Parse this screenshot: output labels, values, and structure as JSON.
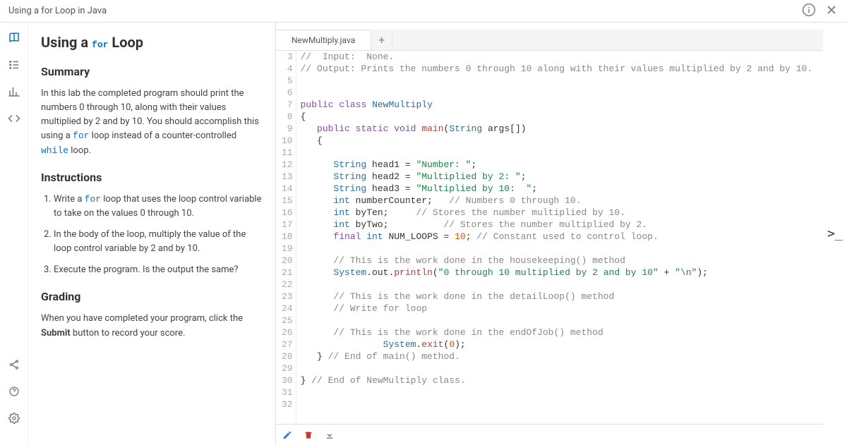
{
  "topbar": {
    "title": "Using a for Loop in Java"
  },
  "sidebar": {
    "icons": [
      "book",
      "list",
      "chart",
      "code"
    ],
    "bottom_icons": [
      "share",
      "help",
      "settings"
    ]
  },
  "instructions": {
    "title_pre": "Using a ",
    "title_code": "for",
    "title_post": " Loop",
    "summary_heading": "Summary",
    "summary_p1_pre": "In this lab the completed program should print the numbers 0 through 10, along with their values multiplied by 2 and by 10. You should accomplish this using a ",
    "summary_p1_code1": "for",
    "summary_p1_mid": " loop instead of a counter-controlled ",
    "summary_p1_code2": "while",
    "summary_p1_post": " loop.",
    "instructions_heading": "Instructions",
    "step1_pre": "Write a ",
    "step1_code": "for",
    "step1_post": " loop that uses the loop control variable to take on the values 0 through 10.",
    "step2": "In the body of the loop, multiply the value of the loop control variable by 2 and by 10.",
    "step3": "Execute the program. Is the output the same?",
    "grading_heading": "Grading",
    "grading_text": "When you have completed your program, click the Submit button to record your score.",
    "grading_bold": "Submit"
  },
  "editor": {
    "tab_name": "NewMultiply.java",
    "add_tab": "+",
    "first_line_number": 3,
    "lines": [
      {
        "n": 3,
        "cmt_full": "//  Input:  None."
      },
      {
        "n": 4,
        "cmt_full": "// Output: Prints the numbers 0 through 10 along with their values multiplied by 2 and by 10."
      },
      {
        "n": 5,
        "plain": ""
      },
      {
        "n": 6,
        "plain": ""
      },
      {
        "n": 7,
        "kw1": "public",
        "kw2": "class",
        "cls": "NewMultiply"
      },
      {
        "n": 8,
        "plain": "{"
      },
      {
        "n": 9,
        "indent": "   ",
        "kw1": "public",
        "kw2": "static",
        "kw3": "void",
        "fn": "main",
        "sig_open": "(",
        "type": "String",
        "sig_rest": " args[])"
      },
      {
        "n": 10,
        "plain": "   {"
      },
      {
        "n": 11,
        "plain": ""
      },
      {
        "n": 12,
        "indent": "      ",
        "type": "String",
        "var": " head1 = ",
        "str": "\"Number: \"",
        "tail": ";"
      },
      {
        "n": 13,
        "indent": "      ",
        "type": "String",
        "var": " head2 = ",
        "str": "\"Multiplied by 2: \"",
        "tail": ";"
      },
      {
        "n": 14,
        "indent": "      ",
        "type": "String",
        "var": " head3 = ",
        "str": "\"Multiplied by 10:  \"",
        "tail": ";"
      },
      {
        "n": 15,
        "indent": "      ",
        "type": "int",
        "var": " numberCounter;   ",
        "cmt": "// Numbers 0 through 10."
      },
      {
        "n": 16,
        "indent": "      ",
        "type": "int",
        "var": " byTen;     ",
        "cmt": "// Stores the number multiplied by 10."
      },
      {
        "n": 17,
        "indent": "      ",
        "type": "int",
        "var": " byTwo;          ",
        "cmt": "// Stores the number multiplied by 2."
      },
      {
        "n": 18,
        "indent": "      ",
        "kw1": "final",
        "type": "int",
        "var": " NUM_LOOPS = ",
        "num": "10",
        "tail": "; ",
        "cmt": "// Constant used to control loop."
      },
      {
        "n": 19,
        "plain": ""
      },
      {
        "n": 20,
        "indent": "      ",
        "cmt": "// This is the work done in the housekeeping() method"
      },
      {
        "n": 21,
        "indent": "      ",
        "cls": "System",
        "mid1": ".out.",
        "fn": "println",
        "mid2": "(",
        "str": "\"0 through 10 multiplied by 2 and by 10\"",
        "mid3": " + ",
        "str2": "\"\\n\"",
        "tail": ");"
      },
      {
        "n": 22,
        "plain": ""
      },
      {
        "n": 23,
        "indent": "      ",
        "cmt": "// This is the work done in the detailLoop() method"
      },
      {
        "n": 24,
        "indent": "      ",
        "cmt": "// Write for loop"
      },
      {
        "n": 25,
        "plain": ""
      },
      {
        "n": 26,
        "indent": "      ",
        "cmt": "// This is the work done in the endOfJob() method"
      },
      {
        "n": 27,
        "indent": "               ",
        "cls": "System",
        "mid1": ".",
        "fn": "exit",
        "mid2": "(",
        "num": "0",
        "tail": ");"
      },
      {
        "n": 28,
        "indent": "   ",
        "plain2": "} ",
        "cmt": "// End of main() method."
      },
      {
        "n": 29,
        "plain": ""
      },
      {
        "n": 30,
        "plain2": "} ",
        "cmt": "// End of NewMultiply class."
      },
      {
        "n": 31,
        "plain": ""
      },
      {
        "n": 32,
        "plain": ""
      }
    ],
    "toolbar": {
      "edit": "edit-icon",
      "delete": "trash-icon",
      "download": "download-icon"
    }
  },
  "terminal_toggle": ">_"
}
